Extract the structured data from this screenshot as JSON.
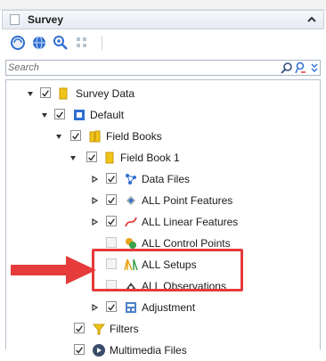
{
  "panel": {
    "title": "Survey"
  },
  "search": {
    "placeholder": "Search"
  },
  "tree": {
    "survey_data": "Survey Data",
    "default": "Default",
    "field_books": "Field Books",
    "field_book_1": "Field Book 1",
    "data_files": "Data Files",
    "all_point_features": "ALL Point Features",
    "all_linear_features": "ALL Linear Features",
    "all_control_points": "ALL Control Points",
    "all_setups": "ALL Setups",
    "all_observations": "ALL Observations",
    "adjustment": "Adjustment",
    "filters": "Filters",
    "multimedia_files": "Multimedia Files"
  },
  "colors": {
    "highlight": "#e53b3b",
    "folder": "#f0c419",
    "accent_blue": "#2f6fd1"
  },
  "icons": [
    "collapse-caret-icon",
    "refresh-icon",
    "globe-icon",
    "zoom-icon",
    "grid-icon",
    "search-icon",
    "person-search-icon",
    "more-icon",
    "folder-icon",
    "database-icon",
    "book-icon",
    "data-files-icon",
    "point-features-icon",
    "linear-features-icon",
    "control-points-icon",
    "setups-icon",
    "observations-icon",
    "adjustment-icon",
    "filters-icon",
    "multimedia-icon"
  ]
}
